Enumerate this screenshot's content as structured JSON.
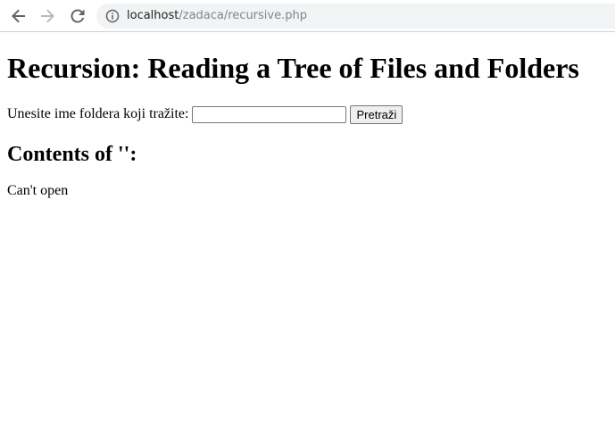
{
  "browser": {
    "url_host": "localhost",
    "url_path": "/zadaca/recursive.php",
    "icons": {
      "back": "arrow-left-icon",
      "forward": "arrow-right-icon",
      "reload": "reload-icon",
      "site_info": "info-icon"
    }
  },
  "page": {
    "title": "Recursion: Reading a Tree of Files and Folders",
    "form": {
      "label": "Unesite ime foldera koji tražite:",
      "input_value": "",
      "submit_label": "Pretraži"
    },
    "contents_heading": "Contents of '':",
    "status_message": "Can't open"
  }
}
